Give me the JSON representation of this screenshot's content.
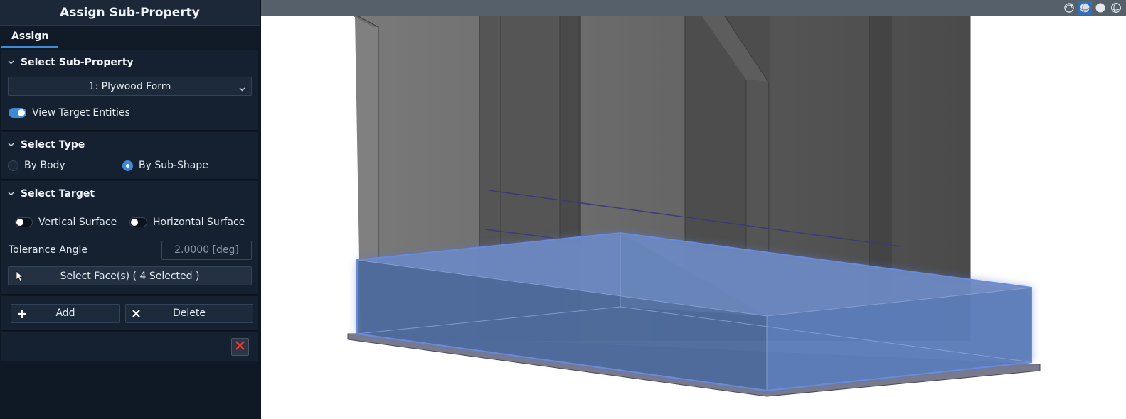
{
  "panel": {
    "title": "Assign Sub-Property",
    "tab_label": "Assign"
  },
  "sub_property": {
    "header": "Select Sub-Property",
    "selected": "1: Plywood Form",
    "view_target_label": "View Target Entities",
    "view_target_on": true
  },
  "select_type": {
    "header": "Select Type",
    "by_body_label": "By Body",
    "by_sub_shape_label": "By Sub-Shape",
    "selected": "By Sub-Shape"
  },
  "select_target": {
    "header": "Select Target",
    "vertical_label": "Vertical Surface",
    "vertical_on": false,
    "horizontal_label": "Horizontal Surface",
    "horizontal_on": false,
    "tolerance_label": "Tolerance Angle",
    "tolerance_value": "2.0000 [deg]",
    "select_faces_label": "Select Face(s) ( 4 Selected )"
  },
  "actions": {
    "add_label": "Add",
    "delete_label": "Delete"
  },
  "viewport": {
    "icons": [
      "camera-orbit-icon",
      "shaded-sphere-icon",
      "solid-sphere-icon",
      "wireframe-sphere-icon"
    ],
    "active_icon": "shaded-sphere-icon"
  },
  "colors": {
    "accent": "#3d8ad8",
    "panel_bg": "#0f1825",
    "selection_blue": "#5a7ab8",
    "close_red": "#e03a2f"
  }
}
